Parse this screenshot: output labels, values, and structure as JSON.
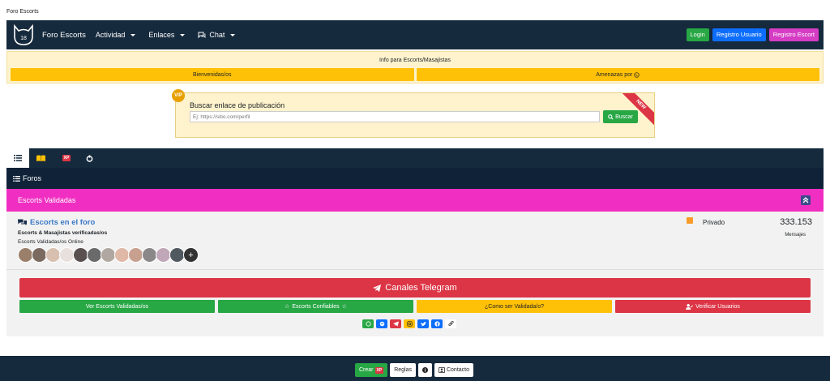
{
  "top_caption": "Foro Escorts",
  "navbar": {
    "logo_text": "18",
    "brand": "Foro Escorts",
    "menu": [
      "Actividad",
      "Enlaces",
      "Chat"
    ],
    "login": "Login",
    "register_user": "Registro Usuario",
    "register_escort": "Registro Escort"
  },
  "info": {
    "title": "Info para Escorts/Masajistas",
    "welcome": "Bienvenidas/os",
    "threats": "Amenazas por"
  },
  "search": {
    "vip": "VIP",
    "title": "Buscar enlace de publicación",
    "placeholder": "Ej: https://sitio.com/perfil",
    "button": "Buscar",
    "ribbon": "NEW"
  },
  "tabs": {
    "xp_label": "XP"
  },
  "forums_header": "Foros",
  "category": "Escorts Validadas",
  "forum": {
    "title": "Escorts en el foro",
    "description": "Escorts & Masajistas verificadas/os",
    "online_label": "Escorts Validadas/os Online",
    "privacy": "Privado",
    "count": "333.153",
    "count_label": "Mensajes",
    "avatar_colors": [
      "#9a7f6a",
      "#7a6a60",
      "#d8c0b0",
      "#e8e0dc",
      "#5a5050",
      "#6a6a6a",
      "#b0a8a0",
      "#e0b8a8",
      "#c8a090",
      "#8a8888",
      "#c0a8b8",
      "#505860"
    ]
  },
  "actions": {
    "telegram": "Canales Telegram",
    "btn1": "Ver Escorts Validadas/os",
    "btn2": "Escorts Confiables",
    "btn3": "¿Como ser Validada/o?",
    "btn4": "Verificar Usuarios"
  },
  "footer": {
    "create": "Crear",
    "xp": "XP",
    "rules": "Reglas",
    "contact": "Contacto"
  },
  "colors": {
    "navy": "#162a3d",
    "pink": "#f02fc2",
    "green": "#28a745",
    "red": "#dc3545",
    "yellow": "#ffc107",
    "blue": "#0d6efd"
  }
}
